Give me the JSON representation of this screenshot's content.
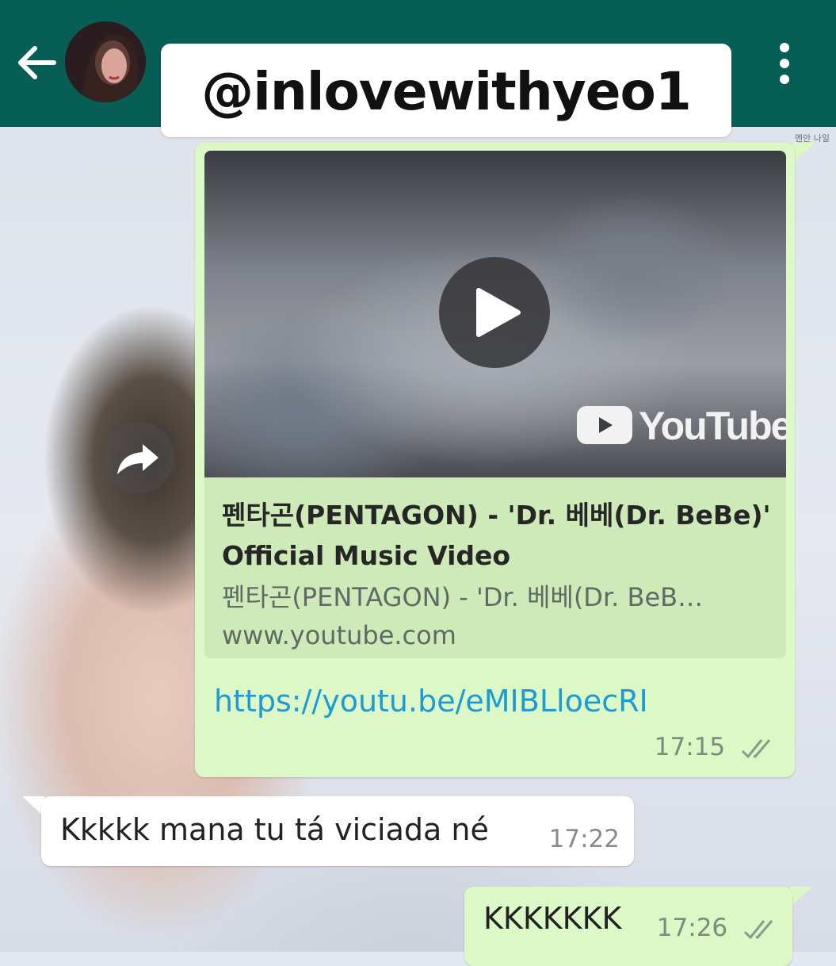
{
  "header": {
    "handle": "@inlovewithyeo1",
    "icons": {
      "back": "arrow-left-icon",
      "menu": "more-vert-icon"
    }
  },
  "wallpaper": {
    "paper_text": "멘안 나일"
  },
  "messages": [
    {
      "direction": "outgoing",
      "preview": {
        "title": "펜타곤(PENTAGON) - 'Dr. 베베(Dr. BeBe)' Official Music Video",
        "description": "펜타곤(PENTAGON) - 'Dr. 베베(Dr. BeB…",
        "domain": "www.youtube.com",
        "brand": "YouTube"
      },
      "link": "https://youtu.be/eMIBLloecRI",
      "time": "17:15",
      "status": "delivered-double-tick"
    },
    {
      "direction": "incoming",
      "text": "Kkkkk mana tu tá viciada né",
      "time": "17:22"
    },
    {
      "direction": "outgoing",
      "text": "KKKKKKK",
      "time": "17:26",
      "status": "delivered-double-tick"
    }
  ],
  "colors": {
    "appbar": "#075e54",
    "bubble_out": "#dcf8c6",
    "bubble_in": "#ffffff",
    "link": "#1e9ad6"
  }
}
